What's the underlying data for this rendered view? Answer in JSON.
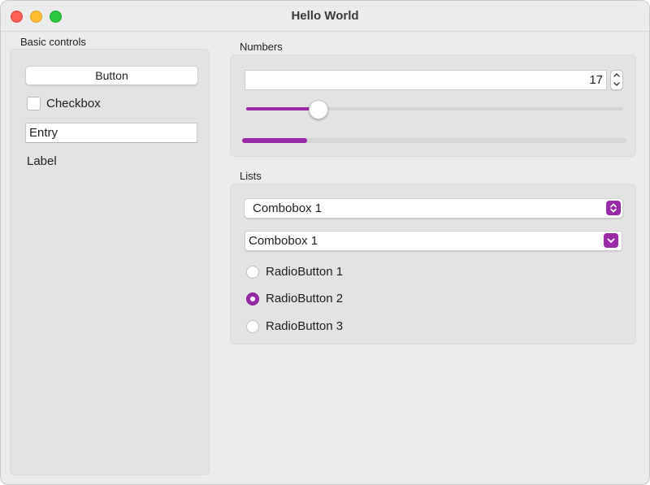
{
  "window": {
    "title": "Hello World"
  },
  "basic_controls": {
    "group_label": "Basic controls",
    "button_label": "Button",
    "checkbox_label": "Checkbox",
    "checkbox_checked": false,
    "entry_value": "Entry",
    "label_text": "Label"
  },
  "numbers": {
    "group_label": "Numbers",
    "spinbox_value": "17",
    "slider_fraction": 0.19,
    "progress_fraction": 0.17
  },
  "lists": {
    "group_label": "Lists",
    "combobox1_value": "Combobox 1",
    "combobox2_value": "Combobox 1",
    "radio_buttons": [
      {
        "label": "RadioButton 1",
        "checked": false
      },
      {
        "label": "RadioButton 2",
        "checked": true
      },
      {
        "label": "RadioButton 3",
        "checked": false
      }
    ]
  },
  "colors": {
    "accent": "#9a29a8",
    "window_bg": "#ececec",
    "group_bg": "#e3e3e3"
  }
}
